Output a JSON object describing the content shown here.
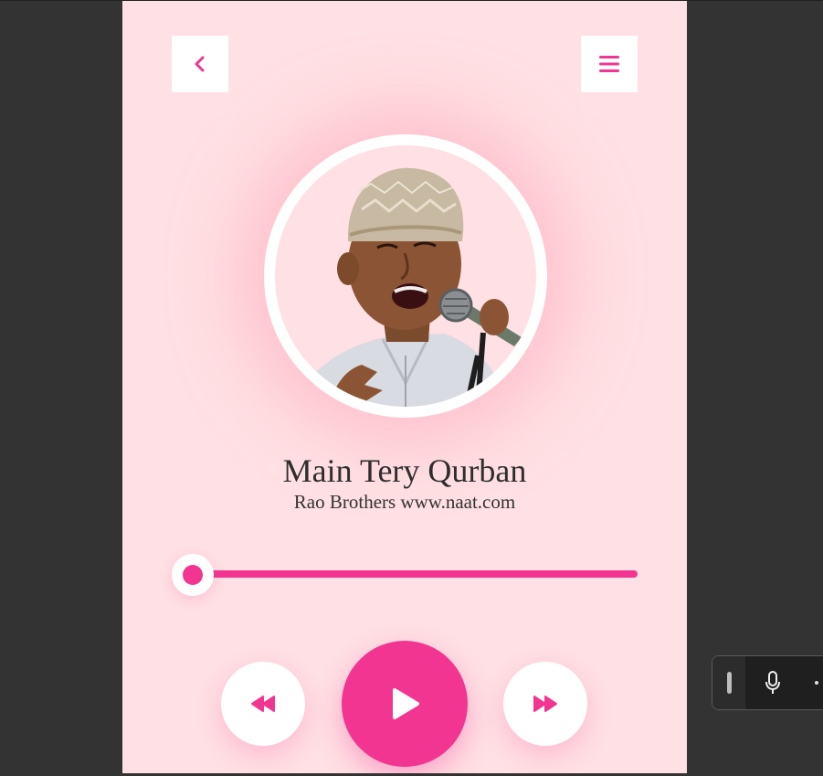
{
  "header": {
    "back_icon": "chevron-left-icon",
    "menu_icon": "hamburger-menu-icon"
  },
  "track": {
    "title": "Main Tery Qurban",
    "artist": "Rao Brothers www.naat.com",
    "progress_fraction": 0
  },
  "controls": {
    "previous_icon": "rewind-icon",
    "play_icon": "play-icon",
    "next_icon": "fast-forward-icon"
  },
  "voice_toolbar": {
    "mic_icon": "microphone-icon",
    "more_icon": "more-options-icon"
  },
  "colors": {
    "accent": "#f23591",
    "background": "#ffe0e4",
    "surface": "#ffffff",
    "outer": "#333333"
  }
}
